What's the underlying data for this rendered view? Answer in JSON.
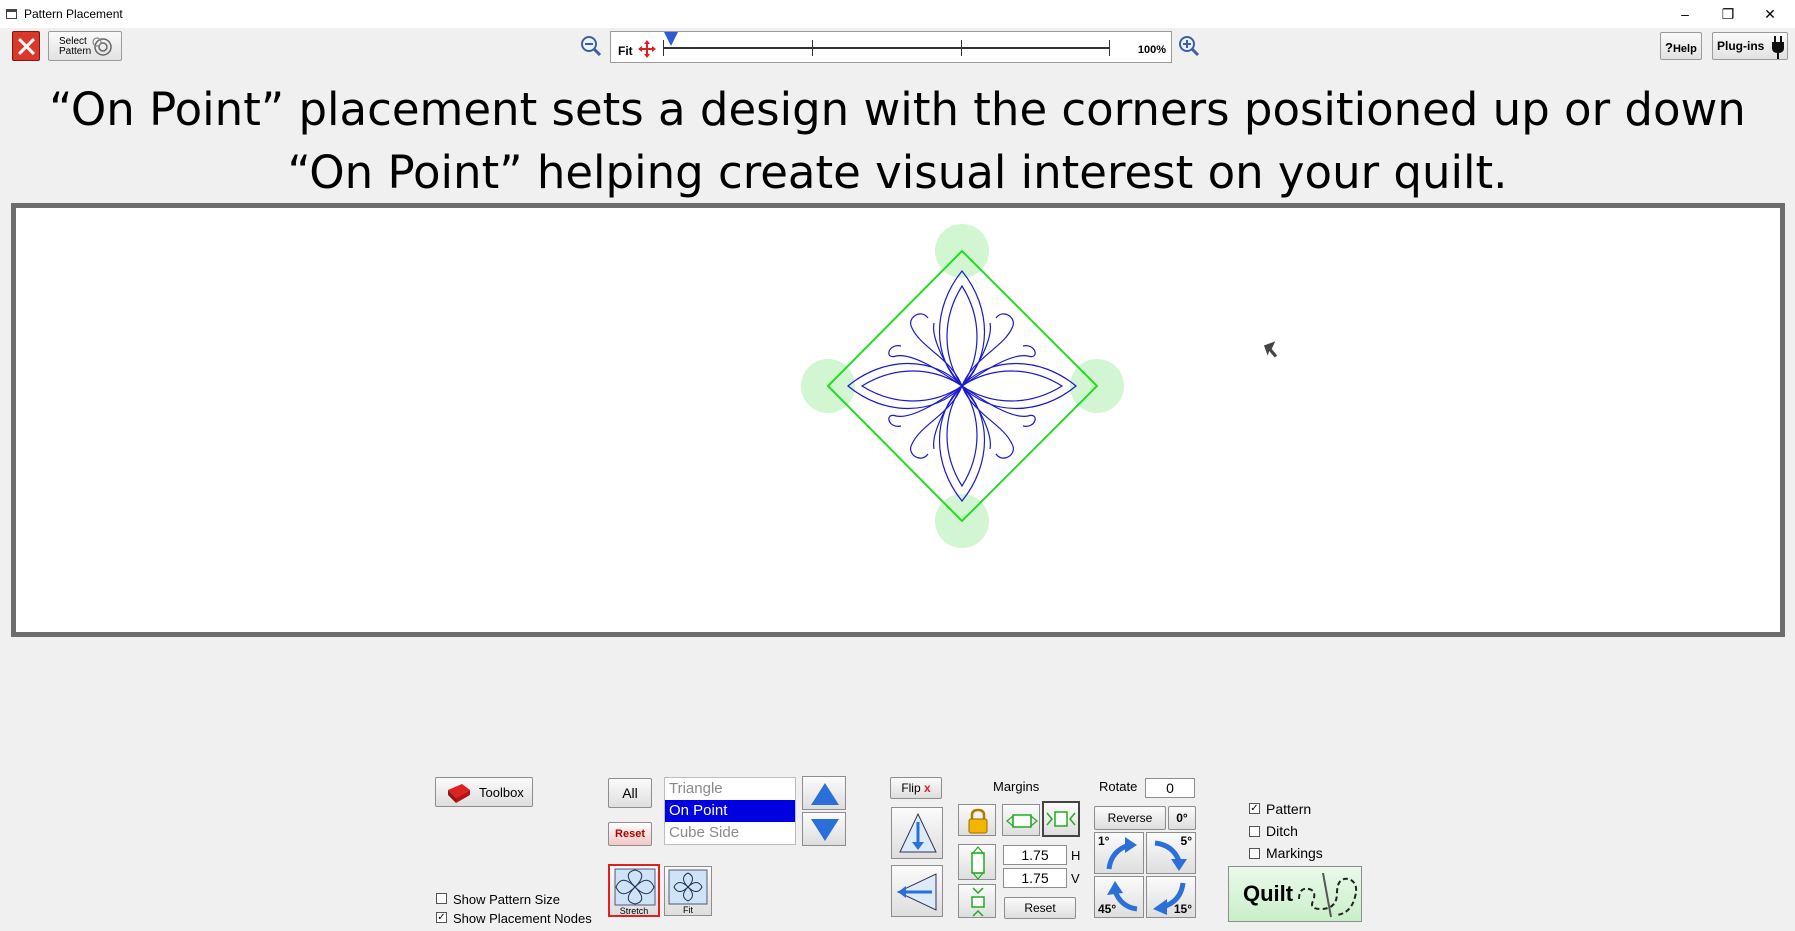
{
  "window": {
    "title": "Pattern Placement",
    "minimize_glyph": "–",
    "restore_glyph": "❐",
    "close_glyph": "✕"
  },
  "toolbar": {
    "select_pattern_line1": "Select",
    "select_pattern_line2": "Pattern",
    "fit_label": "Fit",
    "zoom_max_label": "100%",
    "help_label": "Help",
    "help_glyph": "?",
    "plugins_label": "Plug-ins"
  },
  "headline": {
    "line1": "“On Point” placement sets a design with the corners positioned up or down",
    "line2": "“On Point” helping create visual interest on your quilt."
  },
  "controls": {
    "toolbox_label": "Toolbox",
    "show_pattern_size_label": "Show Pattern Size",
    "show_pattern_size_checked": false,
    "show_placement_nodes_label": "Show Placement Nodes",
    "show_placement_nodes_checked": true,
    "all_label": "All",
    "reset_label": "Reset",
    "placement_list": [
      "Triangle",
      "On Point",
      "Cube Side"
    ],
    "placement_selected": "On Point",
    "stretch_label": "Stretch",
    "fit_label": "Fit",
    "flip_label": "Flip",
    "flip_mark": "x",
    "margins_label": "Margins",
    "margin_h_value": "1.75",
    "margin_h_label": "H",
    "margin_v_value": "1.75",
    "margin_v_label": "V",
    "margins_reset_label": "Reset",
    "rotate_label": "Rotate",
    "rotate_value": "0",
    "reverse_label": "Reverse",
    "zero_deg_label": "0°",
    "rot_1_label": "1°",
    "rot_5_label": "5°",
    "rot_45_label": "45°",
    "rot_15_label": "15°",
    "pattern_label": "Pattern",
    "pattern_checked": true,
    "ditch_label": "Ditch",
    "ditch_checked": false,
    "markings_label": "Markings",
    "markings_checked": false,
    "quilt_label": "Quilt"
  },
  "colors": {
    "diamond_green": "#22dd22",
    "node_green": "#c8f5c8",
    "pattern_blue": "#1a1acc",
    "selection_blue": "#0000e0",
    "close_red": "#d9382b"
  }
}
